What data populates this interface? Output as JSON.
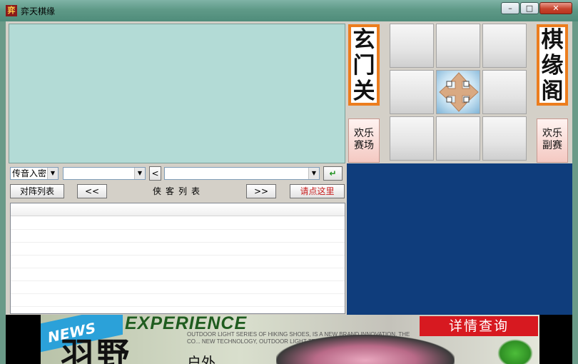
{
  "window": {
    "title": "弈天棋缘",
    "icon_glyph": "弈",
    "controls": {
      "minimize": "–",
      "maximize": "□",
      "close": "✕"
    }
  },
  "toolbar": {
    "mode_select": "传音入密",
    "target_select": "",
    "message_select": "",
    "back_label": "<",
    "enter_label": "↵"
  },
  "list_panel": {
    "pairs_button": "对阵列表",
    "prev_button": "<<",
    "caption": "侠客列表",
    "next_button": ">>",
    "click_here_button": "请点这里",
    "rows": []
  },
  "hall": {
    "left_sign": [
      "玄",
      "门",
      "关"
    ],
    "right_sign": [
      "棋",
      "缘",
      "阁"
    ],
    "left_button": [
      "欢乐",
      "赛场"
    ],
    "right_button": [
      "欢乐",
      "副赛"
    ]
  },
  "ad_banner": {
    "news": "NEWS",
    "headline": "EXPERIENCE",
    "blurb": "OUTDOOR LIGHT SERIES OF HIKING SHOES, IS A NEW BRAND INNOVATION, THE CO... NEW TECHNOLOGY, OUTDOOR LIGHT TRAVEL EQU...",
    "brush_text": "羽野",
    "small_text": "户外",
    "cta": "详情查询"
  },
  "colors": {
    "titlebar": "#5f9a88",
    "mint_panel": "#b3dbd6",
    "blue_panel": "#0f3d7c",
    "sign_border": "#ec7d1e",
    "cta_red": "#d71920"
  }
}
